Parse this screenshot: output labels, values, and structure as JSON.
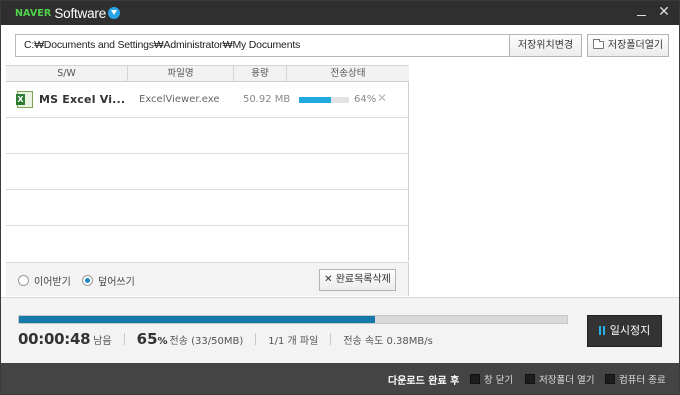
{
  "titlebar": {
    "brand_naver": "NAVER",
    "brand_software": "Software",
    "brand_icon": "download-circle-icon",
    "min_icon": "minimize-icon",
    "close_icon": "close-icon",
    "close_glyph": "✕"
  },
  "path": {
    "value": "C:₩Documents and Settings₩Administrator₩My Documents",
    "change_location_label": "저장위치변경",
    "open_folder_label": "저장폴더열기",
    "open_folder_icon": "folder-icon"
  },
  "table": {
    "columns": [
      "S/W",
      "파일명",
      "용량",
      "전송상태"
    ],
    "rows": [
      {
        "icon": "excel-icon",
        "name": "MS Excel Vi...",
        "filename": "ExcelViewer.exe",
        "size": "50.92 MB",
        "progress": 0.64,
        "percent": "64%",
        "remove_glyph": "✕"
      }
    ]
  },
  "options": {
    "resume_label": "이어받기",
    "overwrite_label": "덮어쓰기",
    "selected": "overwrite",
    "clear_label": "완료목록삭제",
    "clear_glyph": "✕"
  },
  "status": {
    "progress": 0.65,
    "time": "00:00:48",
    "time_suffix": "남음",
    "percent": "65",
    "percent_unit": "%",
    "percent_label": "전송 (33/50MB)",
    "files": "1/1 개 파일",
    "speed": "전송 속도 0.38MB/s",
    "pause_label": "일시정지",
    "pause_icon": "pause-icon",
    "accent": "#1479a8"
  },
  "footer": {
    "after_label": "다운로드 완료 후",
    "options": [
      "창 닫기",
      "저장폴더 열기",
      "컴퓨터 종료"
    ]
  }
}
